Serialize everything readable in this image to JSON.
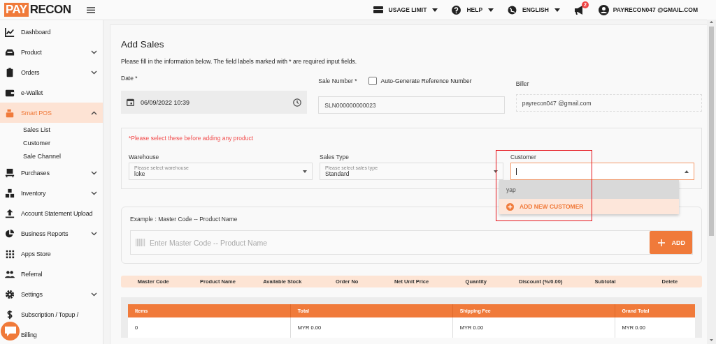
{
  "topbar": {
    "logo_a": "PAY",
    "logo_b": "RECON",
    "menus": [
      {
        "label": "USAGE LIMIT"
      },
      {
        "label": "HELP"
      },
      {
        "label": "ENGLISH"
      }
    ],
    "notification_count": "2",
    "user": "PAYRECON047 @GMAIL.COM"
  },
  "sidebar": {
    "items": [
      {
        "label": "Dashboard",
        "kind": "link",
        "selected": false
      },
      {
        "label": "Product",
        "kind": "group",
        "expanded": false,
        "selected": false
      },
      {
        "label": "Orders",
        "kind": "group",
        "expanded": false,
        "selected": false
      },
      {
        "label": "e-Wallet",
        "kind": "link",
        "selected": false
      },
      {
        "label": "Smart POS",
        "kind": "group",
        "expanded": true,
        "selected": true,
        "children": [
          {
            "label": "Sales List",
            "selected": false
          },
          {
            "label": "Customer",
            "selected": false
          },
          {
            "label": "Sale Channel",
            "selected": false
          }
        ]
      },
      {
        "label": "Purchases",
        "kind": "group",
        "expanded": false,
        "selected": false
      },
      {
        "label": "Inventory",
        "kind": "group",
        "expanded": false,
        "selected": false
      },
      {
        "label": "Account Statement Upload",
        "kind": "link",
        "selected": false
      },
      {
        "label": "Business Reports",
        "kind": "group",
        "expanded": false,
        "selected": false
      },
      {
        "label": "Apps Store",
        "kind": "link",
        "selected": false
      },
      {
        "label": "Referral",
        "kind": "link",
        "selected": false
      },
      {
        "label": "Settings",
        "kind": "group",
        "expanded": false,
        "selected": false
      },
      {
        "label": "Subscription / Topup /",
        "kind": "link",
        "selected": false
      },
      {
        "label": "Billing",
        "kind": "link",
        "selected": false
      }
    ]
  },
  "page": {
    "title": "Add Sales",
    "intro": "Please fill in the information below. The field labels marked with * are required input fields.",
    "date": {
      "label": "Date *",
      "value": "06/09/2022 10:39"
    },
    "sale_number": {
      "label": "Sale Number *",
      "value": "SLN000000000023",
      "auto_generate": {
        "label": "Auto-Generate Reference Number",
        "checked": false
      }
    },
    "biller": {
      "label": "Biller",
      "value": "payrecon047 @gmail.com"
    },
    "notice": "*Please select these before adding any product",
    "selects": [
      {
        "label": "Warehouse",
        "placeholder": "Please select warehouse",
        "value": "loke",
        "focused": false
      },
      {
        "label": "Sales Type",
        "placeholder": "Please select sales type",
        "value": "Standard",
        "focused": false
      },
      {
        "label": "Customer",
        "focused": true
      }
    ],
    "customer_dropdown": {
      "options": [
        {
          "label": "yap",
          "selected": true
        }
      ],
      "add_new": "ADD NEW CUSTOMER"
    },
    "product_search": {
      "hint": "Example : Master Code -- Product Name",
      "placeholder": "Enter Master Code -- Product Name",
      "button": "ADD"
    },
    "item_columns": [
      "Master Code",
      "Product Name",
      "Available Stock",
      "Order No",
      "Net Unit Price",
      "Quantity",
      "Discount (%/0.00)",
      "Subtotal",
      "Delete"
    ],
    "totals": {
      "columns": [
        "Items",
        "Total",
        "Shipping Fee",
        "Grand Total"
      ],
      "row": [
        "0",
        "MYR 0.00",
        "MYR 0.00",
        "MYR 0.00"
      ]
    }
  }
}
